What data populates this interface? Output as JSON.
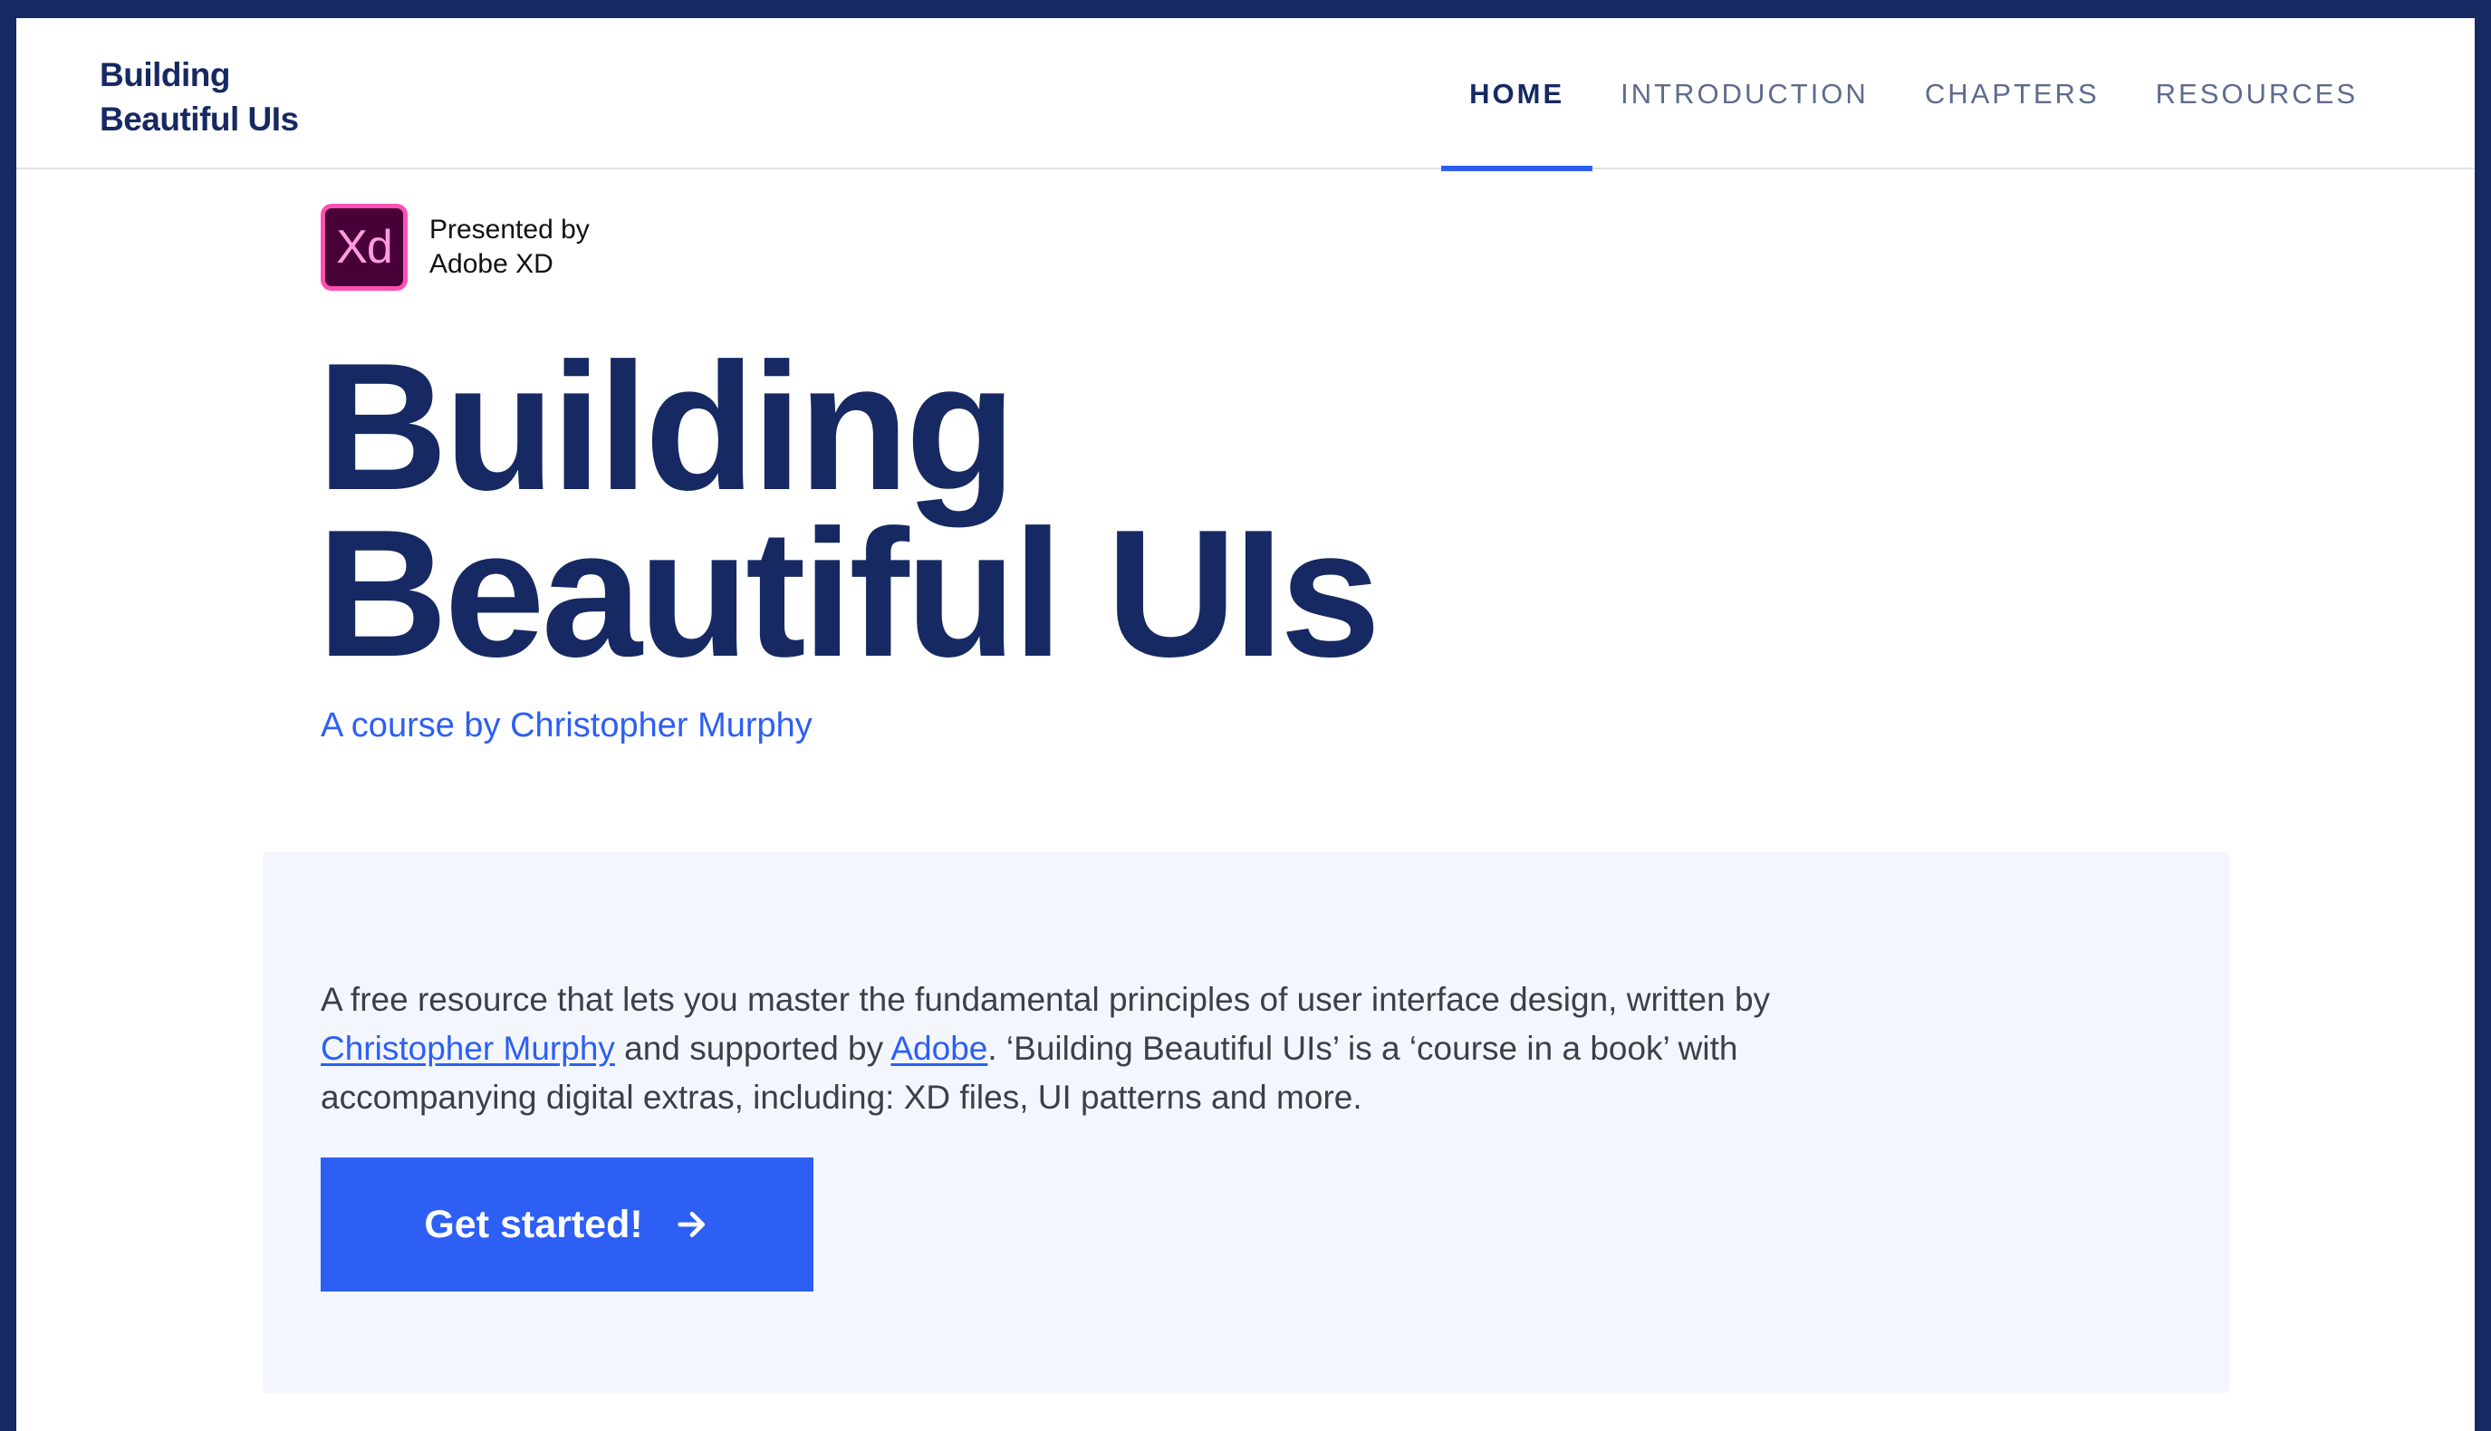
{
  "header": {
    "logo_line1": "Building",
    "logo_line2": "Beautiful UIs",
    "nav": [
      {
        "label": "HOME",
        "active": true
      },
      {
        "label": "INTRODUCTION",
        "active": false
      },
      {
        "label": "CHAPTERS",
        "active": false
      },
      {
        "label": "RESOURCES",
        "active": false
      }
    ]
  },
  "presenter": {
    "badge_text": "Xd",
    "line1": "Presented by",
    "line2": "Adobe XD"
  },
  "hero": {
    "title_line1": "Building",
    "title_line2": "Beautiful UIs",
    "subtitle": "A course by Christopher Murphy"
  },
  "intro": {
    "part1": "A free resource that lets you master the fundamental principles of user interface design, written by ",
    "link1": "Christopher Murphy",
    "part2": " and supported by ",
    "link2": "Adobe",
    "part3": ". ‘Building Beautiful UIs’ is a ‘course in a book’ with accompanying digital extras, including: XD files, UI patterns and more."
  },
  "cta": {
    "label": "Get started!",
    "icon": "arrow-right-icon"
  },
  "colors": {
    "navy": "#172963",
    "accent_blue": "#2d5ff5",
    "card_bg": "#f3f7fd",
    "xd_bg": "#470137",
    "xd_border": "#ff4fb7"
  }
}
